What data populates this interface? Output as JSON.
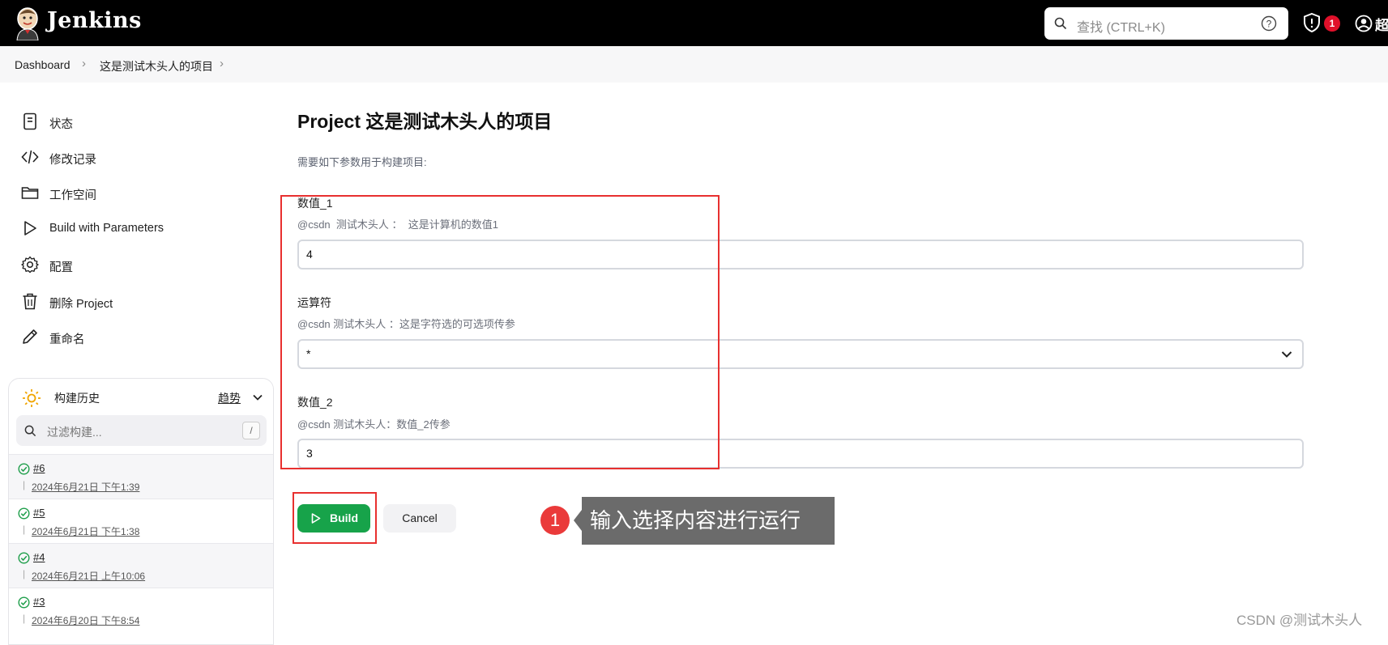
{
  "header": {
    "brand": "Jenkins",
    "search_placeholder": "查找 (CTRL+K)",
    "notification_count": "1",
    "user_name": "超"
  },
  "breadcrumb": [
    "Dashboard",
    "这是测试木头人的项目"
  ],
  "sidebar": {
    "items": [
      {
        "label": "状态",
        "icon": "status-document-icon"
      },
      {
        "label": "修改记录",
        "icon": "code-icon"
      },
      {
        "label": "工作空间",
        "icon": "folder-icon"
      },
      {
        "label": "Build with Parameters",
        "icon": "play-icon"
      },
      {
        "label": "配置",
        "icon": "gear-icon"
      },
      {
        "label": "删除 Project",
        "icon": "trash-icon"
      },
      {
        "label": "重命名",
        "icon": "pencil-icon"
      }
    ],
    "history": {
      "title": "构建历史",
      "trend_label": "趋势",
      "filter_placeholder": "过滤构建...",
      "filter_key": "/",
      "builds": [
        {
          "num": "#6",
          "time": "2024年6月21日 下午1:39"
        },
        {
          "num": "#5",
          "time": "2024年6月21日 下午1:38"
        },
        {
          "num": "#4",
          "time": "2024年6月21日 上午10:06"
        },
        {
          "num": "#3",
          "time": "2024年6月20日 下午8:54"
        }
      ]
    }
  },
  "main": {
    "title": "Project 这是测试木头人的项目",
    "description": "需要如下参数用于构建项目:",
    "params": [
      {
        "name": "数值_1",
        "desc": "@csdn  测试木头人 ：  这是计算机的数值1",
        "value": "4"
      },
      {
        "name": "运算符",
        "desc": "@csdn 测试木头人 ：这是字符选的可选项传参",
        "value": "*"
      },
      {
        "name": "数值_2",
        "desc": "@csdn 测试木头人：数值_2传参",
        "value": "3"
      }
    ],
    "build_label": "Build",
    "cancel_label": "Cancel"
  },
  "annotation": {
    "step": "1",
    "text": "输入选择内容进行运行"
  },
  "watermark": "CSDN @测试木头人",
  "colors": {
    "build_green": "#17a34a",
    "annotation_red": "#e8302f",
    "badge_red": "#e0102a"
  }
}
